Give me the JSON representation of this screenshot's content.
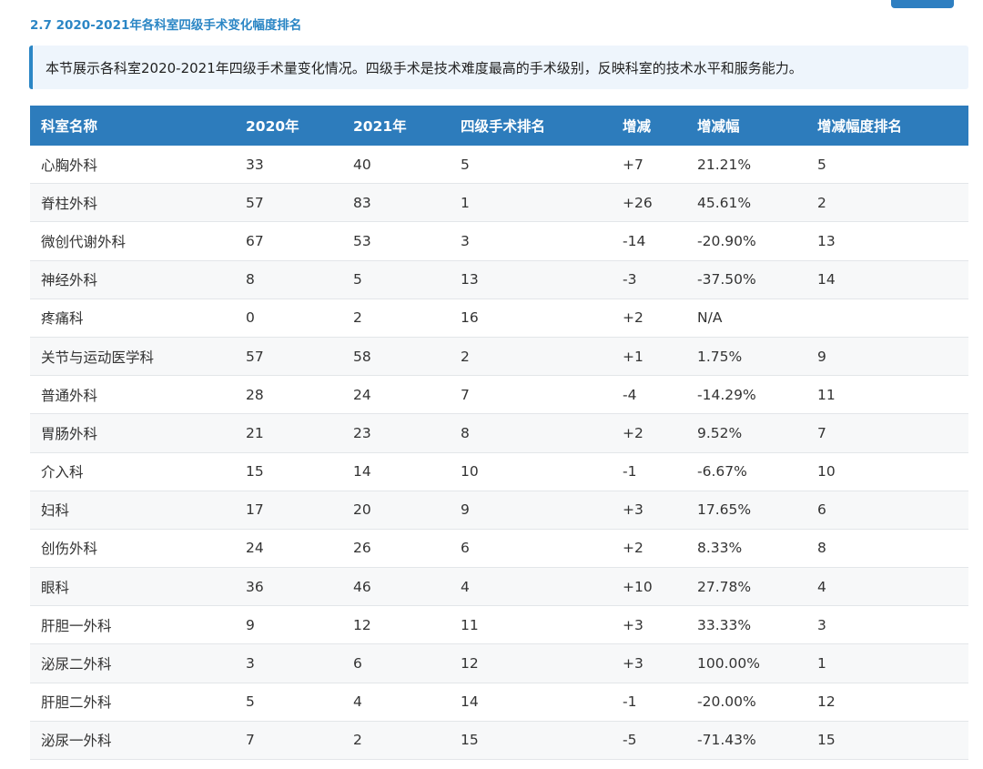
{
  "section": {
    "title": "2.7 2020-2021年各科室四级手术变化幅度排名",
    "note": "本节展示各科室2020-2021年四级手术量变化情况。四级手术是技术难度最高的手术级别，反映科室的技术水平和服务能力。"
  },
  "colors": {
    "accent": "#2b86c5",
    "header_bg": "#2d7cbc",
    "note_bg": "#eef5fc"
  },
  "table": {
    "headers": [
      "科室名称",
      "2020年",
      "2021年",
      "四级手术排名",
      "增减",
      "增减幅",
      "增减幅度排名"
    ],
    "rows": [
      [
        "心胸外科",
        "33",
        "40",
        "5",
        "+7",
        "21.21%",
        "5"
      ],
      [
        "脊柱外科",
        "57",
        "83",
        "1",
        "+26",
        "45.61%",
        "2"
      ],
      [
        "微创代谢外科",
        "67",
        "53",
        "3",
        "-14",
        "-20.90%",
        "13"
      ],
      [
        "神经外科",
        "8",
        "5",
        "13",
        "-3",
        "-37.50%",
        "14"
      ],
      [
        "疼痛科",
        "0",
        "2",
        "16",
        "+2",
        "N/A",
        ""
      ],
      [
        "关节与运动医学科",
        "57",
        "58",
        "2",
        "+1",
        "1.75%",
        "9"
      ],
      [
        "普通外科",
        "28",
        "24",
        "7",
        "-4",
        "-14.29%",
        "11"
      ],
      [
        "胃肠外科",
        "21",
        "23",
        "8",
        "+2",
        "9.52%",
        "7"
      ],
      [
        "介入科",
        "15",
        "14",
        "10",
        "-1",
        "-6.67%",
        "10"
      ],
      [
        "妇科",
        "17",
        "20",
        "9",
        "+3",
        "17.65%",
        "6"
      ],
      [
        "创伤外科",
        "24",
        "26",
        "6",
        "+2",
        "8.33%",
        "8"
      ],
      [
        "眼科",
        "36",
        "46",
        "4",
        "+10",
        "27.78%",
        "4"
      ],
      [
        "肝胆一外科",
        "9",
        "12",
        "11",
        "+3",
        "33.33%",
        "3"
      ],
      [
        "泌尿二外科",
        "3",
        "6",
        "12",
        "+3",
        "100.00%",
        "1"
      ],
      [
        "肝胆二外科",
        "5",
        "4",
        "14",
        "-1",
        "-20.00%",
        "12"
      ],
      [
        "泌尿一外科",
        "7",
        "2",
        "15",
        "-5",
        "-71.43%",
        "15"
      ]
    ]
  }
}
